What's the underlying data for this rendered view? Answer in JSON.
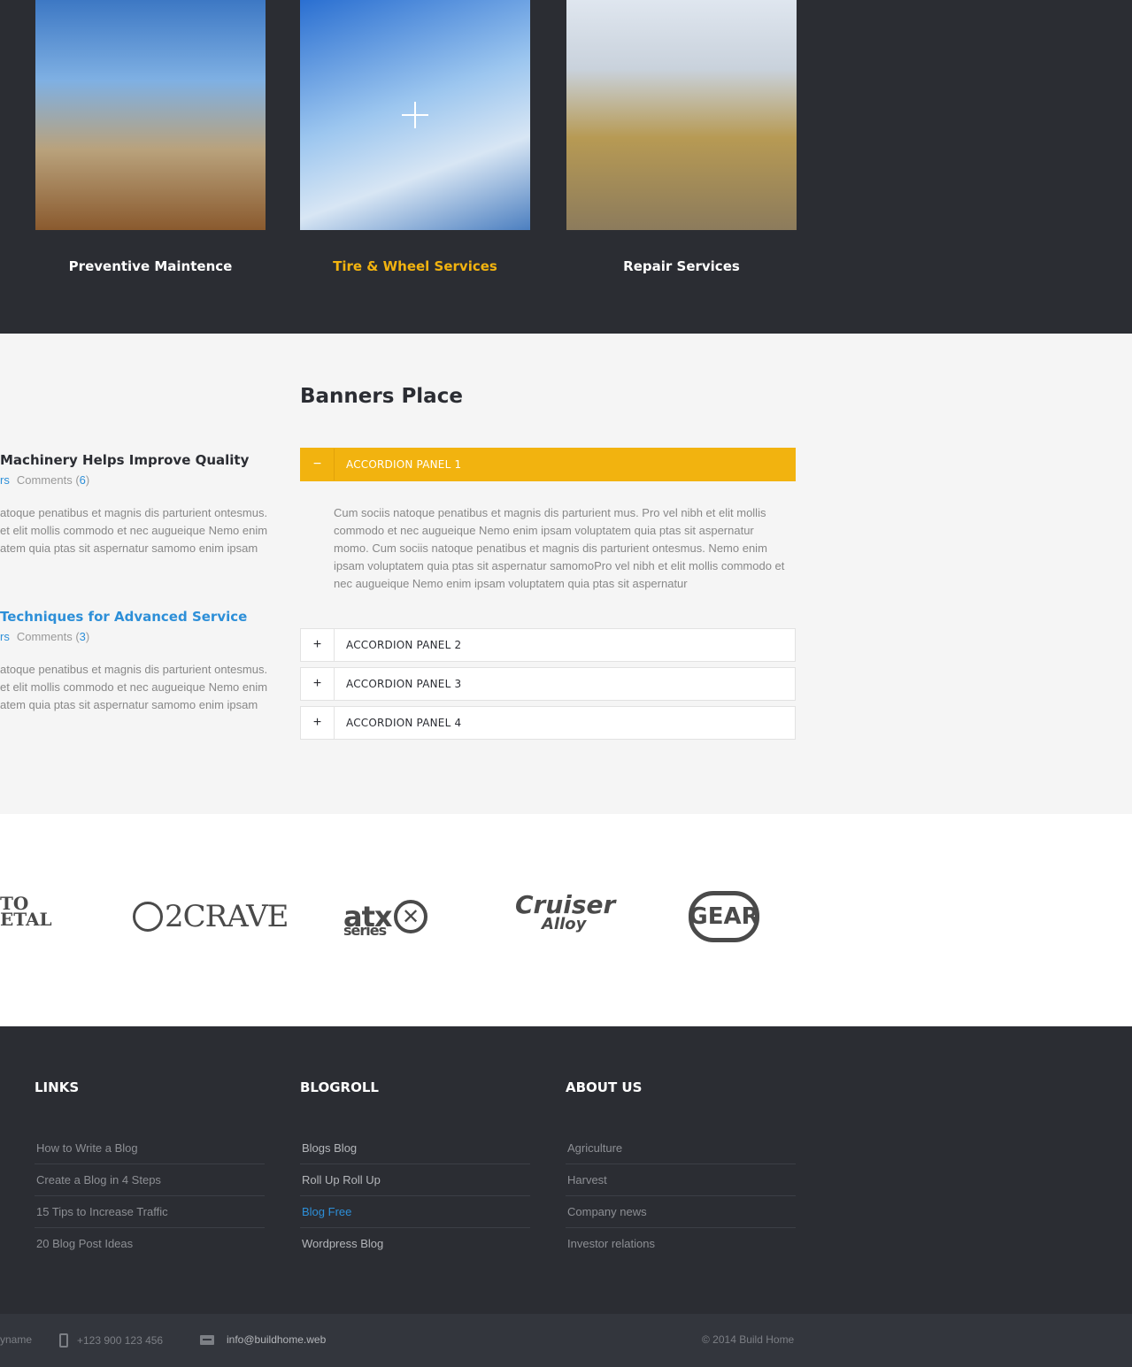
{
  "services": [
    {
      "title": "Preventive Maintence",
      "active": false
    },
    {
      "title": "Tire & Wheel Services",
      "active": true
    },
    {
      "title": "Repair Services",
      "active": false
    }
  ],
  "posts": [
    {
      "title": "Machinery Helps Improve Quality",
      "author": "rs",
      "comments_label": "Comments",
      "comments_count": "6",
      "excerpt": "atoque penatibus et magnis dis parturient ontesmus. et elit mollis commodo et nec augueique Nemo enim atem quia ptas sit aspernatur samomo enim ipsam"
    },
    {
      "title": "Techniques for Advanced Service",
      "author": "rs",
      "comments_label": "Comments",
      "comments_count": "3",
      "excerpt": "atoque penatibus et magnis dis parturient ontesmus. et elit mollis commodo et nec augueique Nemo enim atem quia ptas sit aspernatur samomo enim ipsam"
    }
  ],
  "banners": {
    "title": "Banners Place",
    "panels": [
      {
        "label": "ACCORDION PANEL 1",
        "toggle": "−",
        "open": true,
        "body": "Cum sociis natoque penatibus et magnis dis parturient mus. Pro vel nibh et elit mollis commodo et nec augueique Nemo enim ipsam voluptatem quia ptas sit aspernatur momo. Cum sociis natoque penatibus et magnis dis parturient ontesmus. Nemo enim ipsam voluptatem quia ptas sit aspernatur samomoPro vel nibh et elit mollis commodo et nec augueique Nemo enim ipsam voluptatem quia ptas sit aspernatur"
      },
      {
        "label": "ACCORDION PANEL 2",
        "toggle": "+",
        "open": false
      },
      {
        "label": "ACCORDION PANEL 3",
        "toggle": "+",
        "open": false
      },
      {
        "label": "ACCORDION PANEL 4",
        "toggle": "+",
        "open": false
      }
    ]
  },
  "logos": [
    {
      "line1": "TO",
      "line2": "ETAL"
    },
    {
      "text": "2CRAVE"
    },
    {
      "text": "atx",
      "sub": "series"
    },
    {
      "text": "Cruiser",
      "sub": "Alloy"
    },
    {
      "text": "GEAR"
    }
  ],
  "footer": {
    "links": {
      "title": "LINKS",
      "items": [
        "How to Write a Blog",
        "Create a Blog in 4 Steps",
        "15 Tips to Increase Traffic",
        "20 Blog Post Ideas"
      ]
    },
    "blogroll": {
      "title": "BLOGROLL",
      "items": [
        "Blogs Blog",
        "Roll Up Roll Up",
        "Blog Free",
        "Wordpress Blog"
      ]
    },
    "about": {
      "title": "ABOUT US",
      "items": [
        "Agriculture",
        "Harvest",
        "Company news",
        "Investor relations"
      ]
    }
  },
  "bottom": {
    "name": "yname",
    "phone": "+123 900 123 456",
    "email": "info@buildhome.web",
    "copyright": "© 2014 Build Home"
  },
  "colors": {
    "accent": "#f2b30f",
    "link": "#2d8fd8",
    "dark": "#2b2d33"
  }
}
